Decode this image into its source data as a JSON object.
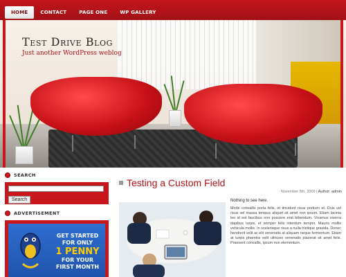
{
  "nav": {
    "items": [
      {
        "label": "HOME",
        "active": true
      },
      {
        "label": "CONTACT",
        "active": false
      },
      {
        "label": "PAGE ONE",
        "active": false
      },
      {
        "label": "WP GALLERY",
        "active": false
      }
    ]
  },
  "header": {
    "title": "Test Drive Blog",
    "tagline": "Just another WordPress weblog"
  },
  "sidebar": {
    "search": {
      "title": "SEARCH",
      "input_value": "",
      "button_label": "Search"
    },
    "advertisement": {
      "title": "ADVERTISEMENT",
      "ad_line1": "GET STARTED",
      "ad_line2": "FOR ONLY",
      "ad_highlight": "1 PENNY",
      "ad_line3": "FOR YOUR",
      "ad_line4": "FIRST MONTH"
    }
  },
  "post": {
    "title": "Testing a Custom Field",
    "date": "November 8th, 2009",
    "author_label": "Author: admin",
    "lead": "Nothing to see here.",
    "body": "Morbi convallis porta felis, et tincidunt risus pretium et. Duis vel risus vel massa tempus aliquet sit amet non ipsum. Etiam lacinia leo id est faucibus non posuere erat bibendum. Vivamus viverra dapibus turpis, et semper felis interdum tempor. Mauris mollis vehicula mollis. In scelerisque risus a nulla tristique gravida. Donec hendrerit velit ac elit venenatis at aliquam neque fermentum. Etiam at turpis pharetra velit ultricies venenatis placerat sit amet felis. Praesent convallis, ipsum non elementum."
  },
  "colors": {
    "brand_red": "#c8161d",
    "title_red": "#b01218"
  },
  "icons": {
    "widget_bullet": "red-circle-bullet-icon",
    "post_marker": "grey-square-icon"
  }
}
